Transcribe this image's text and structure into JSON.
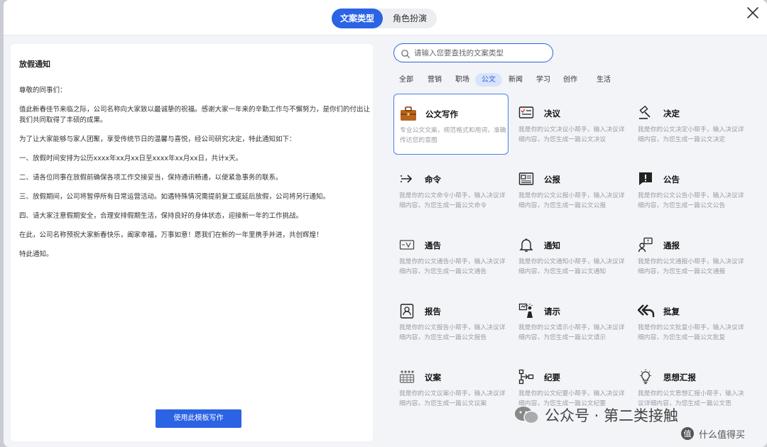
{
  "header": {
    "tabs": [
      {
        "label": "文案类型",
        "active": true
      },
      {
        "label": "角色扮演",
        "active": false
      }
    ]
  },
  "preview": {
    "title": "放假通知",
    "paragraphs": [
      "尊敬的同事们：",
      "值此新春佳节来临之际，公司名称向大家致以最诚挚的祝福。感谢大家一年来的辛勤工作与不懈努力，是你们的付出让我们共同取得了丰硕的成果。",
      "为了让大家能够与家人团聚，享受传统节日的温馨与喜悦，经公司研究决定，特此通知如下：",
      "一、放假时间安排为公历xxxx年xx月xx日至xxxx年xx月xx日，共计x天。",
      "二、请各位同事在放假前确保各项工作交接妥当，保持通讯畅通，以便紧急事务的联系。",
      "三、放假期间，公司将暂停所有日常运营活动。如遇特殊情况需提前复工或延后放假，公司将另行通知。",
      "四、请大家注意假期安全，合理安排假期生活，保持良好的身体状态，迎接新一年的工作挑战。",
      "在此，公司名称预祝大家新春快乐，阖家幸福，万事如意！愿我们在新的一年里携手并进，共创辉煌！",
      "特此通知。"
    ],
    "use_button": "使用此模板写作"
  },
  "search": {
    "placeholder": "请输入您要查找的文案类型"
  },
  "categories": [
    "全部",
    "营销",
    "职场",
    "公文",
    "新闻",
    "学习",
    "创作",
    "生活"
  ],
  "active_category": "公文",
  "cards": [
    {
      "title": "公文写作",
      "icon": "briefcase-icon",
      "desc": "专业公文文案，规范格式和用词，准确传达您的意图",
      "selected": true
    },
    {
      "title": "决议",
      "icon": "resolution-board-icon",
      "desc": "我是你的公文决议小帮手，输入决议详细内容，为您生成一篇公文决议"
    },
    {
      "title": "决定",
      "icon": "gavel-icon",
      "desc": "我是你的公文决定小帮手，输入决议详细内容，为您生成一篇公文决定"
    },
    {
      "title": "命令",
      "icon": "command-arrow-icon",
      "desc": "我是你的公文命令小帮手，输入决议详细内容，为您生成一篇公文命令"
    },
    {
      "title": "公报",
      "icon": "newspaper-icon",
      "desc": "我是你的公文公报小帮手，输入决议详细内容，为您生成一篇公文公报"
    },
    {
      "title": "公告",
      "icon": "announcement-icon",
      "desc": "我是你的公文公告小帮手，输入决议详细内容，为您生成一篇公文公告"
    },
    {
      "title": "通告",
      "icon": "notice-board-icon",
      "desc": "我是你的公文通告小帮手，输入决议详细内容，为您生成一篇公文通告"
    },
    {
      "title": "通知",
      "icon": "bell-icon",
      "desc": "我是你的公文通知小帮手，输入决议详细内容，为您生成一篇公文通知"
    },
    {
      "title": "通报",
      "icon": "speaker-person-icon",
      "desc": "我是你的公文通报小帮手，输入决议详细内容，为您生成一篇公文通报"
    },
    {
      "title": "报告",
      "icon": "report-badge-icon",
      "desc": "我是你的公文报告小帮手，输入决议详细内容，为您生成一篇公文报告"
    },
    {
      "title": "请示",
      "icon": "presentation-icon",
      "desc": "我是你的公文请示小帮手，输入决议详细内容，为您生成一篇公文请示"
    },
    {
      "title": "批复",
      "icon": "reply-all-icon",
      "desc": "我是你的公文批复小帮手，输入决议详细内容，为您生成一篇公文批复"
    },
    {
      "title": "议案",
      "icon": "meeting-icon",
      "desc": "我是你的公文议案小帮手，输入决议详细内容，为您生成一篇公文议案"
    },
    {
      "title": "纪要",
      "icon": "flow-chart-icon",
      "desc": "我是你的公文纪要小帮手，输入决议详细内容，为您生成一篇公文纪要"
    },
    {
      "title": "思想汇报",
      "icon": "lightbulb-icon",
      "desc": "我是你的公文思想汇报小帮手，输入决议详细内容，为您生成一篇公文思"
    }
  ],
  "watermarks": {
    "main": "公众号 · 第二类接触",
    "secondary": "什么值得买"
  },
  "colors": {
    "accent": "#2b63e4",
    "active_category_bg": "#d9e4fb"
  }
}
